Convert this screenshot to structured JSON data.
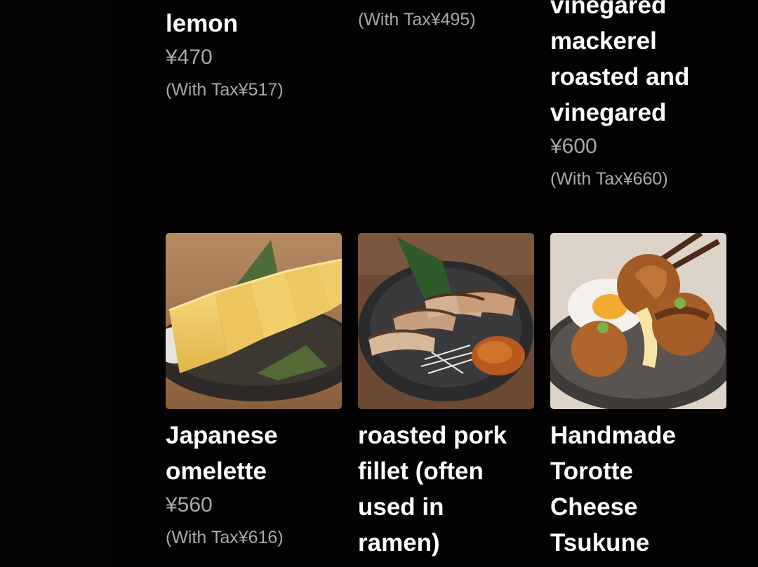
{
  "menu": {
    "top_row": [
      {
        "name_lines": [
          "lemon"
        ],
        "price": "¥470",
        "tax": "(With Tax¥517)"
      },
      {
        "name_lines": [],
        "price": "",
        "tax": "(With Tax¥495)"
      },
      {
        "name_lines": [
          "vinegared",
          "mackerel",
          "roasted and",
          "vinegared"
        ],
        "price": "¥600",
        "tax": "(With Tax¥660)"
      }
    ],
    "items": [
      {
        "name_lines": [
          "Japanese",
          "omelette"
        ],
        "price": "¥560",
        "tax": "(With Tax¥616)",
        "image": "japanese-omelette-photo"
      },
      {
        "name_lines": [
          "roasted pork",
          "fillet (often",
          "used in",
          "ramen)"
        ],
        "price": "",
        "tax": "",
        "image": "roasted-pork-photo"
      },
      {
        "name_lines": [
          "Handmade",
          "Torotte",
          "Cheese",
          "Tsukune"
        ],
        "price": "",
        "tax": "",
        "image": "cheese-tsukune-photo"
      }
    ]
  }
}
